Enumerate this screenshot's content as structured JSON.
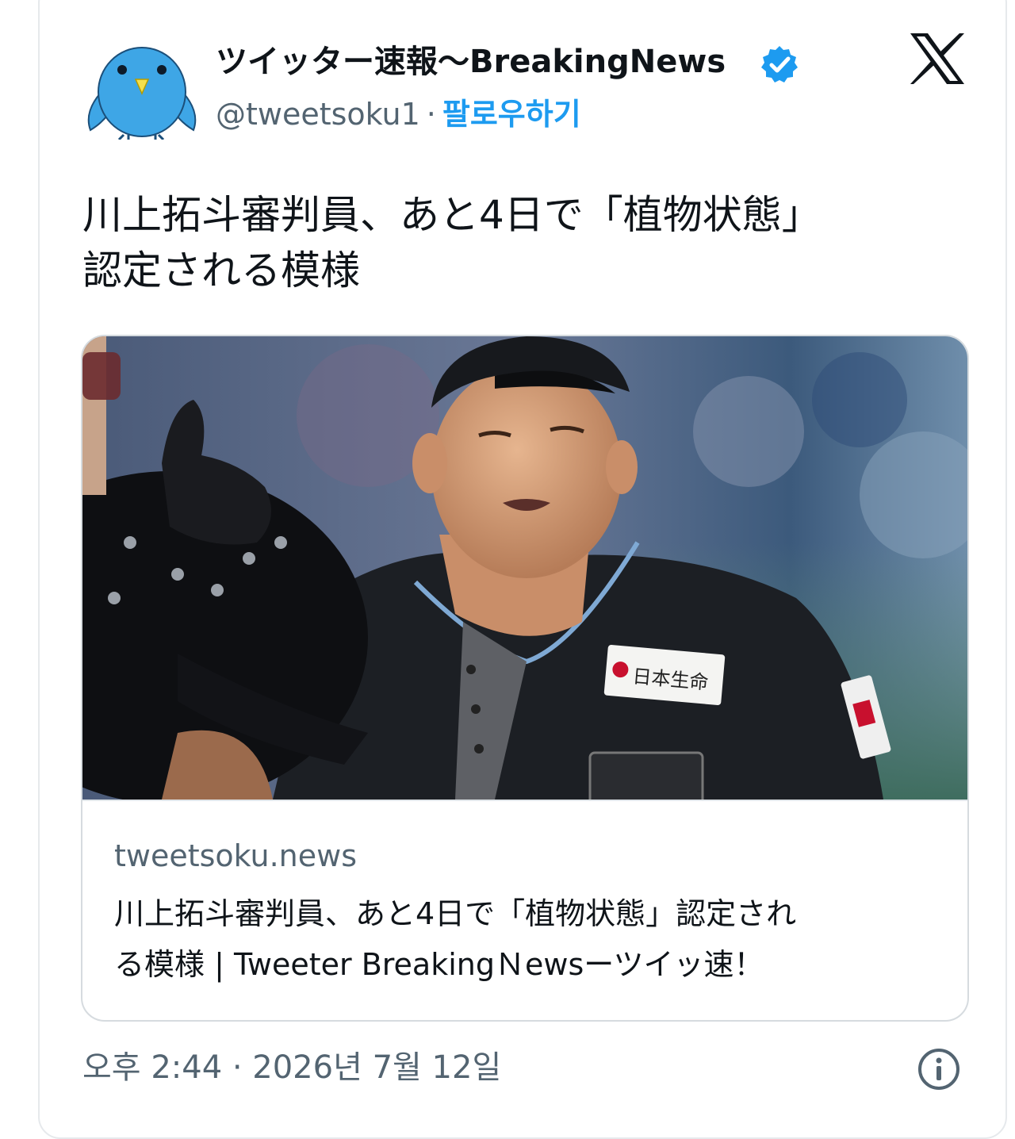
{
  "tweet": {
    "display_name": "ツイッター速報〜BreakingNews",
    "handle": "@tweetsoku1",
    "separator": "·",
    "follow_label": "팔로우하기",
    "text_line1": "川上拓斗審判員、あと4日で「植物状態」",
    "text_line2": "認定される模様",
    "avatar_icon": "blue-bird-avatar-icon",
    "verified_icon": "verified-badge-icon",
    "platform_logo": "x-logo-icon"
  },
  "link_card": {
    "domain": "tweetsoku.news",
    "title_line1": "川上拓斗審判員、あと4日で「植物状態」認定され",
    "title_line2": "る模様 | Tweeter BreakingＮewsーツイッ速！",
    "image_badge_text": "日本生命"
  },
  "footer": {
    "timestamp": "오후 2:44 · 2026년 7월 12일",
    "info_icon": "info-icon"
  },
  "colors": {
    "accent": "#1d9bf0",
    "text_primary": "#0f1419",
    "text_secondary": "#536471",
    "border": "#e6e9ec"
  }
}
